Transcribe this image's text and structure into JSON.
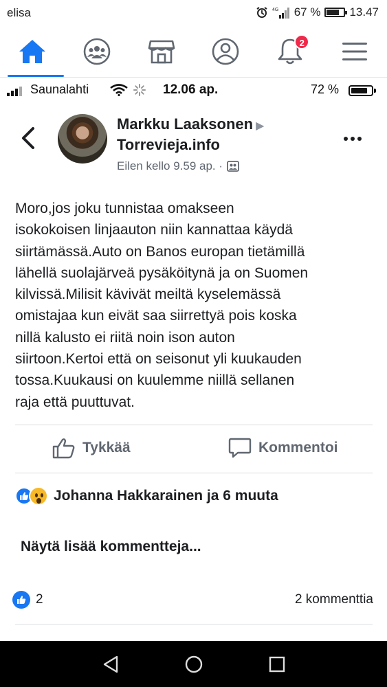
{
  "outer_status": {
    "carrier": "elisa",
    "network": "4G",
    "battery_percent": "67 %",
    "battery_level": 0.67,
    "time": "13.47"
  },
  "fb_nav": {
    "items": [
      "home-icon",
      "groups-icon",
      "marketplace-icon",
      "profile-icon",
      "notifications-icon",
      "menu-icon"
    ],
    "active": "home-icon",
    "notification_count": "2",
    "accent": "#1877f2",
    "badge_color": "#f02849"
  },
  "inner_status": {
    "carrier": "Saunalahti",
    "time": "12.06 ap.",
    "battery_percent": "72 %",
    "battery_level": 0.72
  },
  "post": {
    "author": "Markku Laaksonen",
    "group": "Torrevieja.info",
    "timestamp": "Eilen kello 9.59 ap. ·",
    "body": "Moro,jos joku tunnistaa omakseen\nisokokoisen linjaauton niin kannattaa käydä\nsiirtämässä.Auto on Banos europan tietämillä\nlähellä suolajärveä pysäköitynä ja on Suomen\nkilvissä.Milisit kävivät meiltä kyselemässä\nomistajaa kun eivät saa siirrettyä pois koska\nnillä kalusto ei riitä noin ison auton\nsiirtoon.Kertoi että on seisonut yli kuukauden\ntossa.Kuukausi on kuulemme niillä sellanen\nraja että puuttuvat."
  },
  "actions": {
    "like_label": "Tykkää",
    "comment_label": "Kommentoi"
  },
  "reactions": {
    "text": "Johanna Hakkarainen ja 6 muuta"
  },
  "comments": {
    "show_more": "Näytä lisää kommentteja..."
  },
  "footer": {
    "like_count": "2",
    "comment_count": "2 kommenttia"
  }
}
